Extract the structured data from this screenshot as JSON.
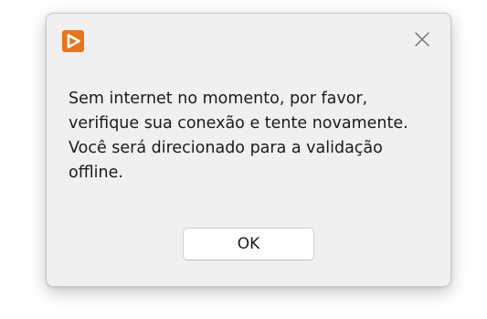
{
  "dialog": {
    "app_icon": "play-logo-icon",
    "close_icon": "close-icon",
    "message": "Sem internet no momento, por favor, verifique sua conexão e tente novamente. Você será direcionado para a validação offline.",
    "ok_label": "OK"
  },
  "colors": {
    "brand_orange": "#e8741c",
    "dialog_background": "#f0f0f0",
    "button_background": "#fdfdfd",
    "text": "#1a1a1a"
  }
}
